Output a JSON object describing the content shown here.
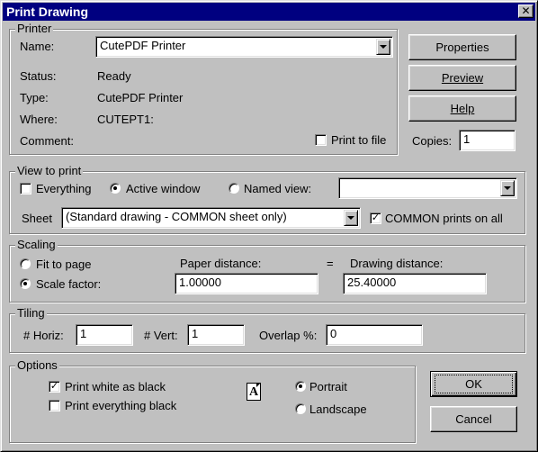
{
  "window": {
    "title": "Print Drawing",
    "close_glyph": "✕"
  },
  "printer": {
    "legend": "Printer",
    "name_label": "Name:",
    "name_value": "CutePDF Printer",
    "status_label": "Status:",
    "status_value": "Ready",
    "type_label": "Type:",
    "type_value": "CutePDF Printer",
    "where_label": "Where:",
    "where_value": "CUTEPT1:",
    "comment_label": "Comment:",
    "print_to_file_label": "Print to file",
    "print_to_file_checked": false,
    "copies_label": "Copies:",
    "copies_value": "1"
  },
  "side_buttons": {
    "properties": "Properties",
    "preview": "Preview",
    "help": "Help"
  },
  "view_to_print": {
    "legend": "View to print",
    "everything_label": "Everything",
    "everything_checked": false,
    "active_window_label": "Active window",
    "active_window_selected": true,
    "named_view_label": "Named view:",
    "named_view_selected": false,
    "named_view_value": "",
    "sheet_label": "Sheet",
    "sheet_value": "(Standard drawing - COMMON sheet only)",
    "common_prints_label": "COMMON prints on all",
    "common_prints_checked": true
  },
  "scaling": {
    "legend": "Scaling",
    "fit_to_page_label": "Fit to page",
    "scale_factor_label": "Scale factor:",
    "selected": "scale_factor",
    "paper_distance_label": "Paper distance:",
    "equals": "=",
    "drawing_distance_label": "Drawing distance:",
    "paper_distance_value": "1.00000",
    "drawing_distance_value": "25.40000"
  },
  "tiling": {
    "legend": "Tiling",
    "horiz_label": "# Horiz:",
    "horiz_value": "1",
    "vert_label": "# Vert:",
    "vert_value": "1",
    "overlap_label": "Overlap %:",
    "overlap_value": "0"
  },
  "options": {
    "legend": "Options",
    "white_as_black_label": "Print white as black",
    "white_as_black_checked": true,
    "everything_black_label": "Print everything black",
    "everything_black_checked": false,
    "orientation_icon_letter": "A",
    "portrait_label": "Portrait",
    "landscape_label": "Landscape",
    "orientation": "portrait"
  },
  "dialog_buttons": {
    "ok": "OK",
    "cancel": "Cancel"
  }
}
